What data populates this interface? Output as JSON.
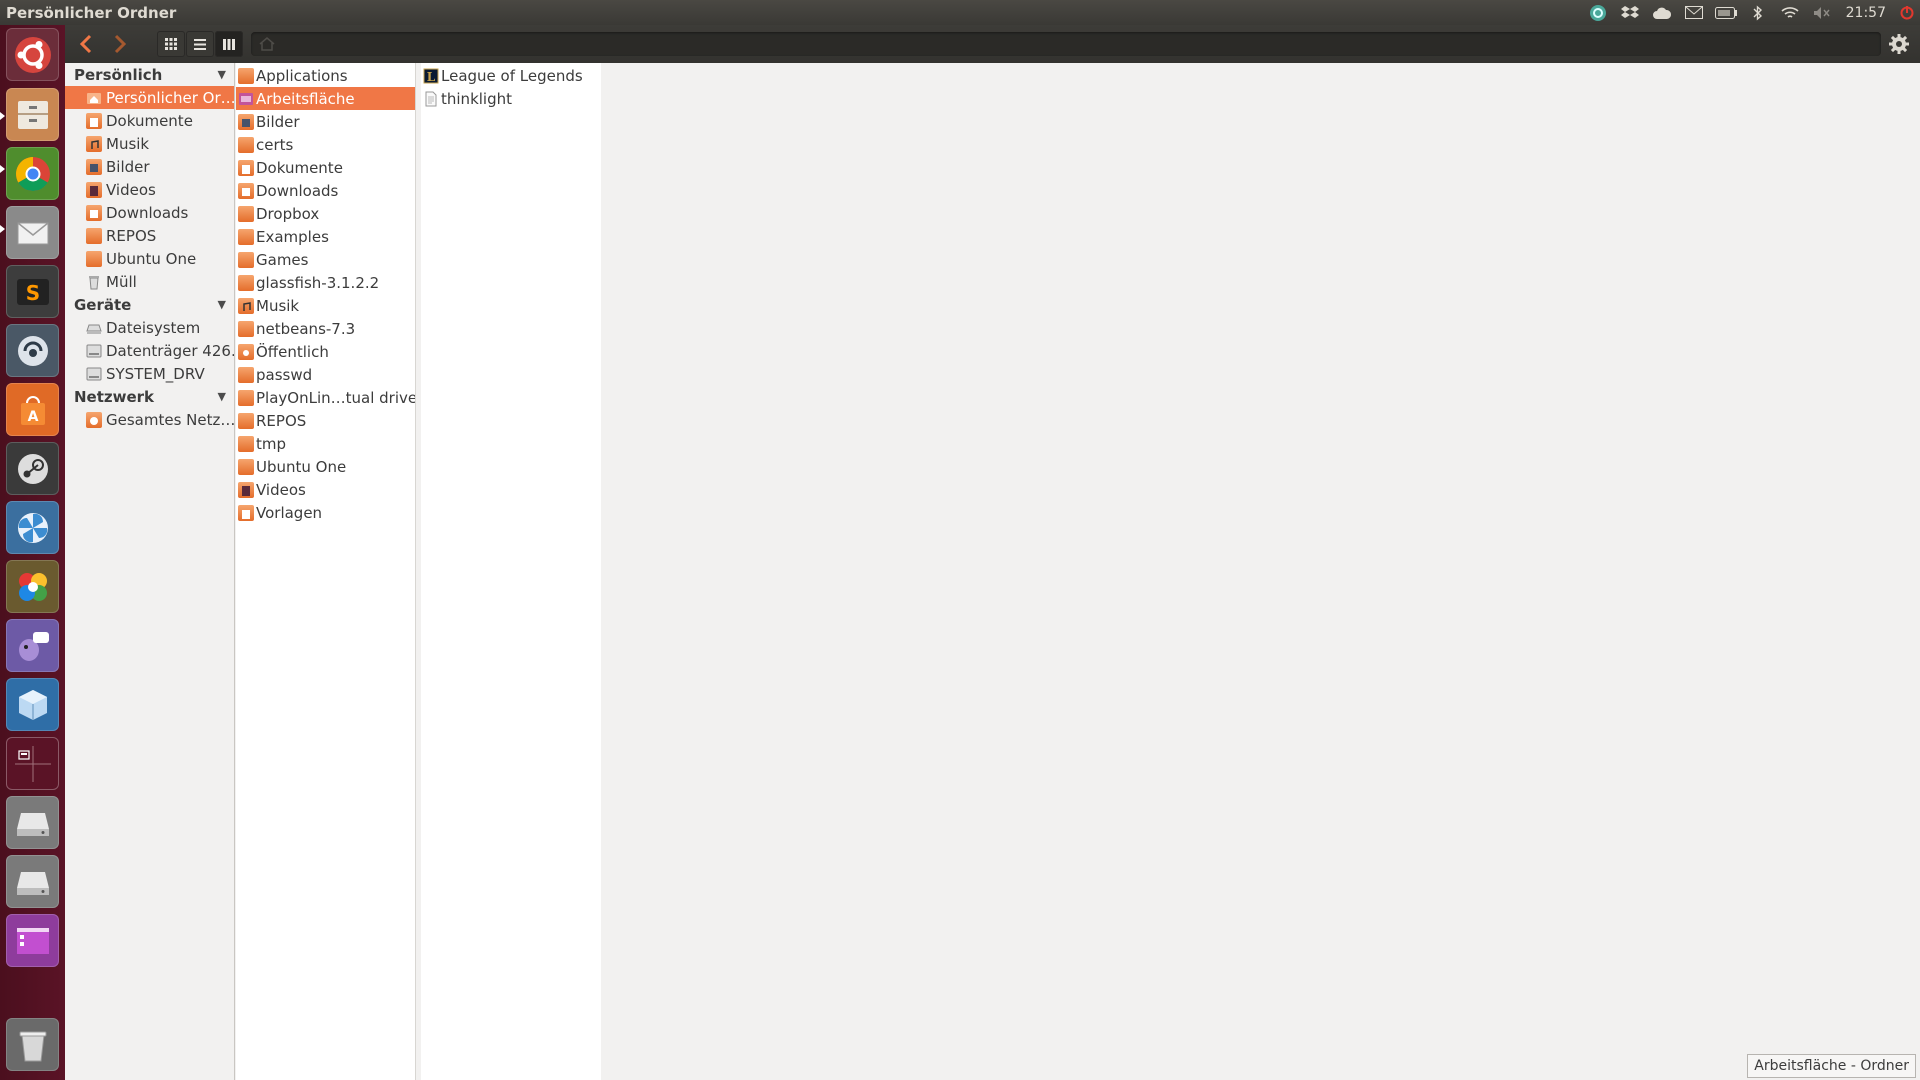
{
  "window": {
    "title": "Persönlicher Ordner"
  },
  "indicators": [
    "dropbox-icon",
    "cloud-icon",
    "mail-icon",
    "battery-icon",
    "bluetooth-icon",
    "wifi-icon",
    "volume-muted-icon"
  ],
  "clock": "21:57",
  "launcher": [
    "ubuntu-dash",
    "files",
    "chrome",
    "mail",
    "sublime-text",
    "teamspeak",
    "software-center",
    "steam",
    "browser",
    "picasa",
    "pidgin",
    "virtualbox",
    "workspace-switcher",
    "drive-1",
    "drive-2",
    "desktop-app",
    "trash"
  ],
  "sidebar": {
    "sections": [
      {
        "title": "Persönlich",
        "items": [
          {
            "label": "Persönlicher Or…",
            "icon": "home-folder-icon",
            "selected": true
          },
          {
            "label": "Dokumente",
            "icon": "documents-folder-icon"
          },
          {
            "label": "Musik",
            "icon": "music-folder-icon"
          },
          {
            "label": "Bilder",
            "icon": "pictures-folder-icon"
          },
          {
            "label": "Videos",
            "icon": "videos-folder-icon"
          },
          {
            "label": "Downloads",
            "icon": "downloads-folder-icon"
          },
          {
            "label": "REPOS",
            "icon": "folder-icon"
          },
          {
            "label": "Ubuntu One",
            "icon": "folder-icon"
          },
          {
            "label": "Müll",
            "icon": "trash-icon"
          }
        ]
      },
      {
        "title": "Geräte",
        "items": [
          {
            "label": "Dateisystem",
            "icon": "filesystem-icon"
          },
          {
            "label": "Datenträger 426…",
            "icon": "drive-icon"
          },
          {
            "label": "SYSTEM_DRV",
            "icon": "drive-icon"
          }
        ]
      },
      {
        "title": "Netzwerk",
        "items": [
          {
            "label": "Gesamtes Netz…",
            "icon": "network-icon"
          }
        ]
      }
    ]
  },
  "columns": {
    "home": [
      {
        "label": "Applications",
        "icon": "folder-icon"
      },
      {
        "label": "Arbeitsfläche",
        "icon": "desktop-folder-icon",
        "selected": true
      },
      {
        "label": "Bilder",
        "icon": "pictures-folder-icon"
      },
      {
        "label": "certs",
        "icon": "folder-icon"
      },
      {
        "label": "Dokumente",
        "icon": "documents-folder-icon"
      },
      {
        "label": "Downloads",
        "icon": "downloads-folder-icon"
      },
      {
        "label": "Dropbox",
        "icon": "folder-icon"
      },
      {
        "label": "Examples",
        "icon": "folder-icon"
      },
      {
        "label": "Games",
        "icon": "folder-icon"
      },
      {
        "label": "glassfish-3.1.2.2",
        "icon": "folder-icon"
      },
      {
        "label": "Musik",
        "icon": "music-folder-icon"
      },
      {
        "label": "netbeans-7.3",
        "icon": "folder-icon"
      },
      {
        "label": "Öffentlich",
        "icon": "public-folder-icon"
      },
      {
        "label": "passwd",
        "icon": "folder-icon"
      },
      {
        "label": "PlayOnLin…tual drives",
        "icon": "folder-icon"
      },
      {
        "label": "REPOS",
        "icon": "folder-icon"
      },
      {
        "label": "tmp",
        "icon": "folder-icon"
      },
      {
        "label": "Ubuntu One",
        "icon": "folder-icon"
      },
      {
        "label": "Videos",
        "icon": "videos-folder-icon"
      },
      {
        "label": "Vorlagen",
        "icon": "templates-folder-icon"
      }
    ],
    "desktop": [
      {
        "label": "League of Legends",
        "icon": "league-of-legends-icon"
      },
      {
        "label": "thinklight",
        "icon": "text-file-icon"
      }
    ]
  },
  "status": "Arbeitsfläche - Ordner",
  "colors": {
    "accent": "#f07746",
    "launcher": "#4b0f1e",
    "panel": "#3c3b37"
  }
}
